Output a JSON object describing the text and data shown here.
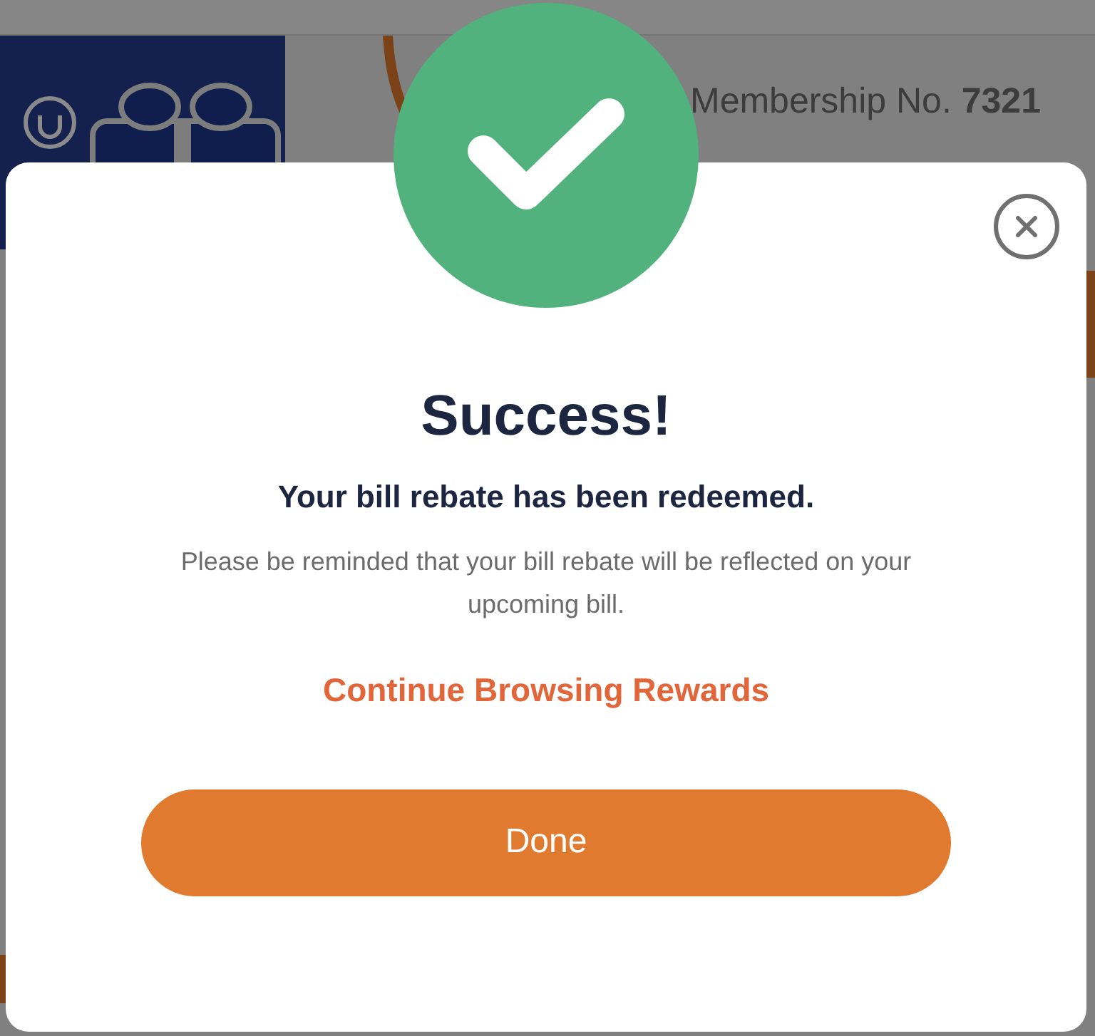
{
  "background": {
    "membership": "Membership No. **7321**"
  },
  "dialog": {
    "title": "Success!",
    "subtitle": "Your bill rebate has been redeemed.",
    "message": "Please be reminded that your bill rebate will be reflected on your upcoming bill.",
    "link": "Continue Browsing Rewards",
    "button": "Done"
  }
}
